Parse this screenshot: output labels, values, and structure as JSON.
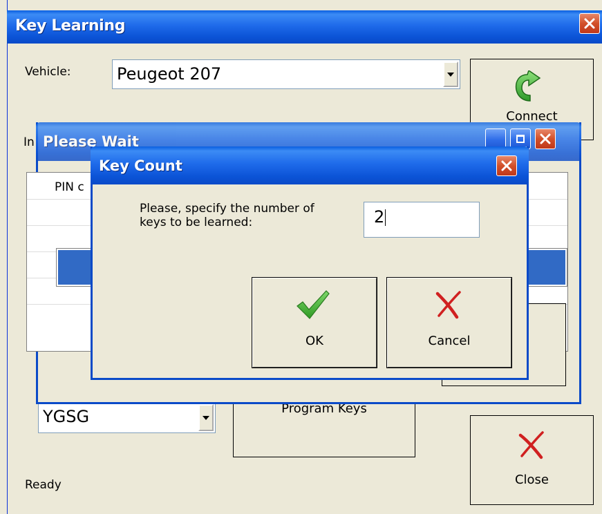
{
  "main_window": {
    "title": "Key Learning",
    "vehicle_label": "Vehicle:",
    "vehicle_value": "Peugeot 207",
    "connect_label": "Connect",
    "partial_label": "In",
    "key_combo_value": "YGSG",
    "program_keys_label": "Program Keys",
    "close_label": "Close",
    "status_text": "Ready"
  },
  "wait_window": {
    "title": "Please Wait",
    "pin_text": "PIN c"
  },
  "key_count_dialog": {
    "title": "Key Count",
    "prompt_line1": "Please, specify the number of",
    "prompt_line2": "keys to be learned:",
    "input_value": "2",
    "ok_label": "OK",
    "cancel_label": "Cancel"
  },
  "icons": {
    "connect": "green-curved-arrow-icon",
    "ok": "green-checkmark-icon",
    "cancel": "red-x-icon",
    "close": "red-x-icon",
    "window_close": "close-icon",
    "dropdown": "chevron-down-icon"
  },
  "colors": {
    "titlebar_blue": "#0A5FE0",
    "close_red": "#D2502A",
    "window_face": "#ECE9D8",
    "progress_blue": "#316AC5"
  },
  "progress": {
    "fraction": 1.0
  }
}
